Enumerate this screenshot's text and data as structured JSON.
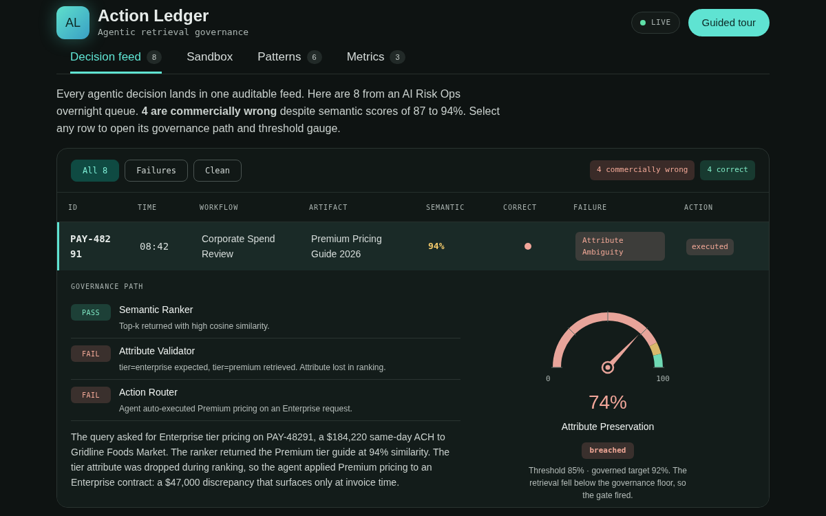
{
  "header": {
    "logo": "AL",
    "title": "Action Ledger",
    "subtitle": "Agentic retrieval governance",
    "status": "LIVE",
    "tour_button": "Guided tour"
  },
  "tabs": [
    {
      "label": "Decision feed",
      "count": "8",
      "selected": true
    },
    {
      "label": "Sandbox",
      "selected": false
    },
    {
      "label": "Patterns",
      "count": "6",
      "selected": false
    },
    {
      "label": "Metrics",
      "count": "3",
      "selected": false
    }
  ],
  "intro": "Every agentic decision lands in one auditable feed. Here are 8 from an AI Risk Ops overnight queue. **4 are commercially wrong** despite semantic scores of 87 to 94%. Select any row to open its governance path and threshold gauge.",
  "filters": [
    {
      "label": "All 8",
      "selected": true
    },
    {
      "label": "Failures",
      "selected": false
    },
    {
      "label": "Clean",
      "selected": false
    }
  ],
  "summary": [
    {
      "kind": "wrong",
      "label": "4 commercially wrong"
    },
    {
      "kind": "correct",
      "label": "4 correct"
    }
  ],
  "table": {
    "columns": [
      "ID",
      "TIME",
      "WORKFLOW",
      "ARTIFACT",
      "SEMANTIC",
      "CORRECT",
      "FAILURE",
      "ACTION"
    ],
    "rows": [
      {
        "id": "PAY-48291",
        "time": "08:42",
        "workflow": "Corporate Spend Review",
        "artifact": "Premium Pricing Guide 2026",
        "semantic": "94%",
        "correct": false,
        "failure": "Attribute Ambiguity",
        "action": "executed",
        "selected": true
      }
    ]
  },
  "detail": {
    "heading": "GOVERNANCE PATH",
    "steps": [
      {
        "kind": "pass",
        "result": "PASS",
        "name": "Semantic Ranker",
        "note": "Top-k returned with high cosine similarity."
      },
      {
        "kind": "fail",
        "result": "FAIL",
        "name": "Attribute Validator",
        "note": "tier=enterprise expected, tier=premium retrieved. Attribute lost in ranking."
      },
      {
        "kind": "fail",
        "result": "FAIL",
        "name": "Action Router",
        "note": "Agent auto-executed Premium pricing on an Enterprise request."
      }
    ],
    "narrative": "The query asked for Enterprise tier pricing on PAY-48291, a $184,220 same-day ACH to Gridline Foods Market. The ranker returned the Premium tier guide at 94% similarity. The tier attribute was dropped during ranking, so the agent applied Premium pricing to an Enterprise contract: a $47,000 discrepancy that surfaces only at invoice time.",
    "gauge": {
      "level": 0.74,
      "min_label": "0",
      "max_label": "100",
      "value": "74%",
      "label": "Attribute Preservation",
      "status": "breached",
      "note": "Threshold 85% · governed target 92%. The retrieval fell below the governance floor, so the gate fired."
    }
  }
}
